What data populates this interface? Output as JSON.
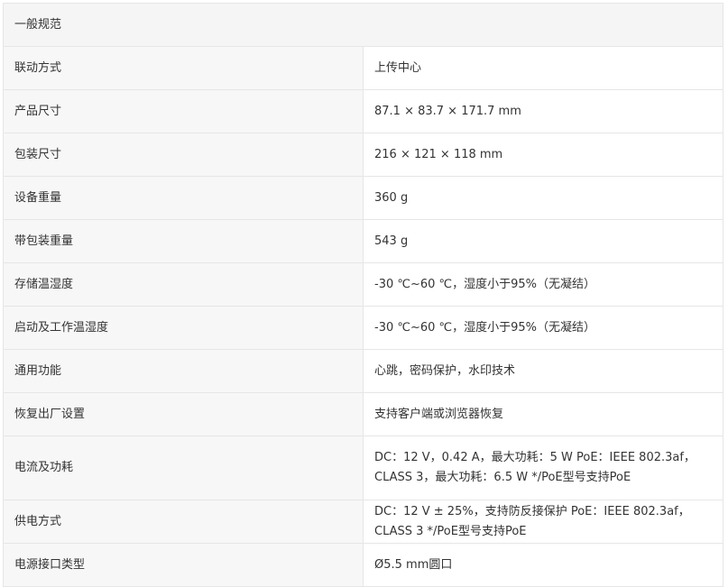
{
  "section": {
    "title": "一般规范"
  },
  "rows": [
    {
      "label": "联动方式",
      "value": "上传中心"
    },
    {
      "label": "产品尺寸",
      "value": "87.1 × 83.7 × 171.7 mm"
    },
    {
      "label": "包装尺寸",
      "value": "216 × 121 × 118 mm"
    },
    {
      "label": "设备重量",
      "value": "360 g"
    },
    {
      "label": "带包装重量",
      "value": "543 g"
    },
    {
      "label": "存储温湿度",
      "value": "-30 ℃~60 ℃，湿度小于95%（无凝结）"
    },
    {
      "label": "启动及工作温湿度",
      "value": "-30 ℃~60 ℃，湿度小于95%（无凝结）"
    },
    {
      "label": "通用功能",
      "value": "心跳，密码保护，水印技术"
    },
    {
      "label": "恢复出厂设置",
      "value": "支持客户端或浏览器恢复"
    },
    {
      "label": "电流及功耗",
      "value": "DC：12 V，0.42 A，最大功耗：5 W PoE：IEEE 802.3af，CLASS 3，最大功耗：6.5 W */PoE型号支持PoE"
    },
    {
      "label": "供电方式",
      "value": "DC：12 V ± 25%，支持防反接保护 PoE：IEEE 802.3af，CLASS 3 */PoE型号支持PoE"
    },
    {
      "label": "电源接口类型",
      "value": "Ø5.5 mm圆口"
    }
  ]
}
